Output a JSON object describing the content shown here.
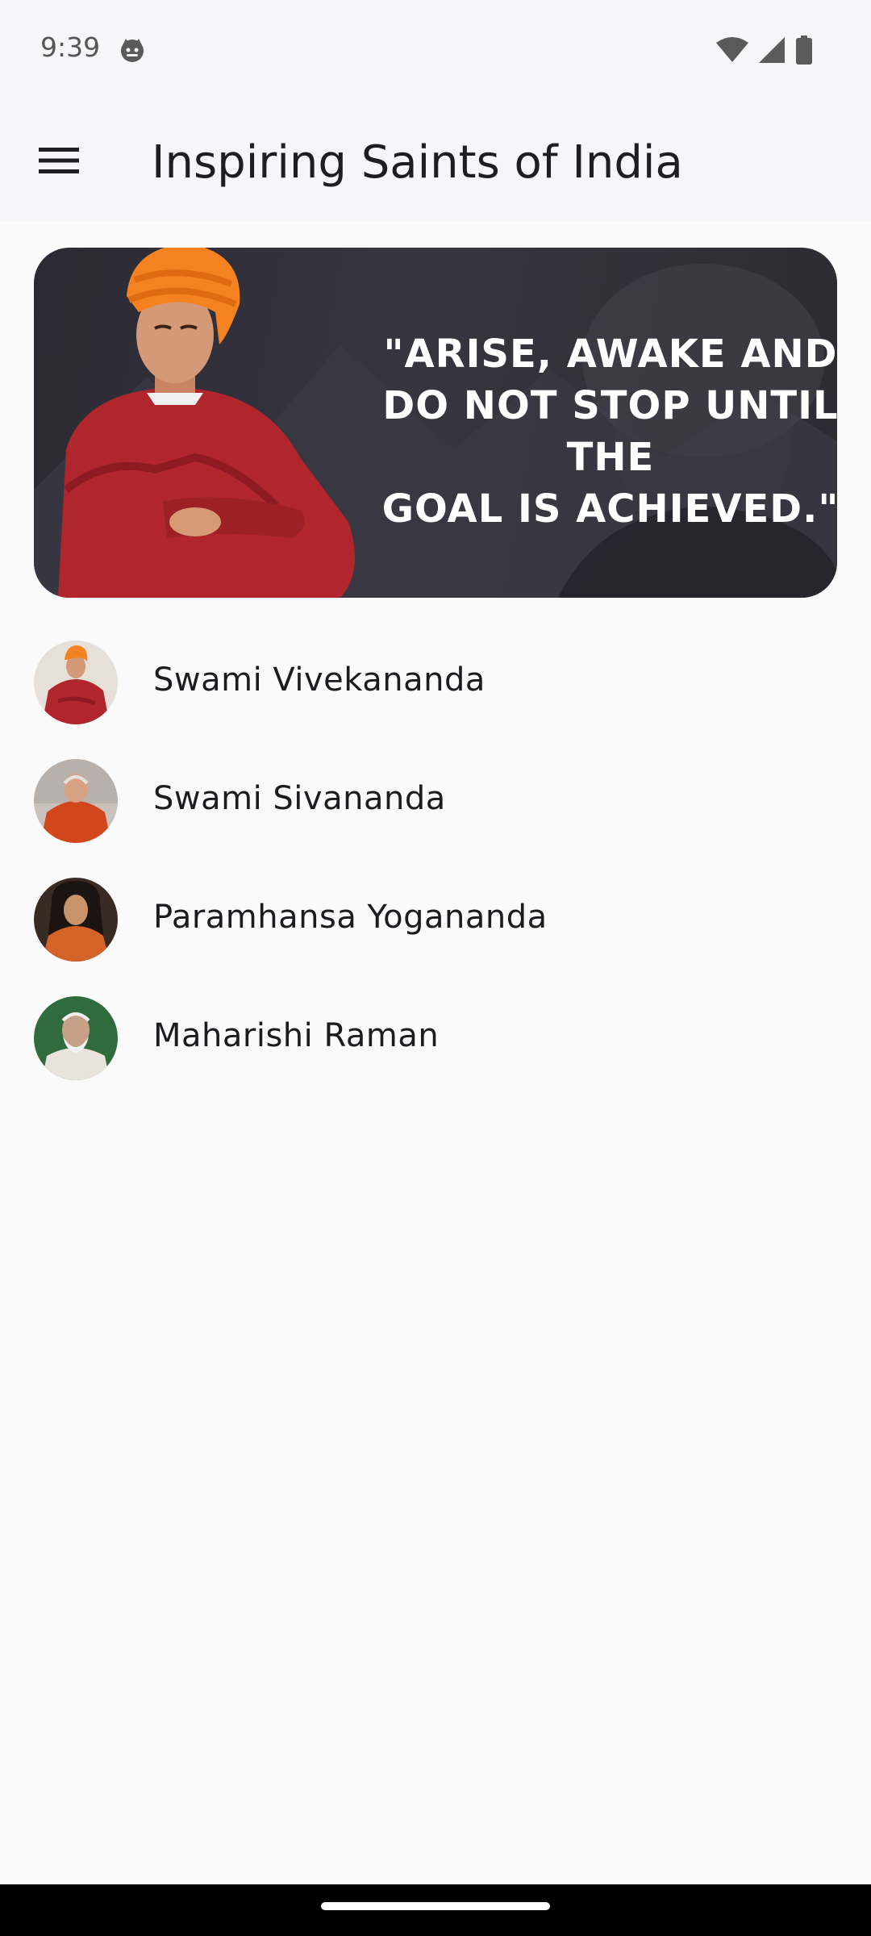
{
  "status_bar": {
    "time": "9:39",
    "icons": [
      "notification-face-icon",
      "wifi-icon",
      "cellular-signal-icon",
      "battery-icon"
    ]
  },
  "app_bar": {
    "title": "Inspiring Saints of India",
    "menu_icon": "hamburger-menu-icon"
  },
  "banner": {
    "quote": "\"Arise, awake and\ndo not stop until the\ngoal is achieved.\""
  },
  "saints": [
    {
      "name": "Swami Vivekananda"
    },
    {
      "name": "Swami Sivananda"
    },
    {
      "name": "Paramhansa Yogananda"
    },
    {
      "name": "Maharishi Raman"
    }
  ],
  "colors": {
    "background": "#fafafa",
    "app_bar": "#f6f6f9",
    "title_text": "#1e1e22",
    "saffron": "#f58220",
    "robe_red": "#b0262c"
  }
}
